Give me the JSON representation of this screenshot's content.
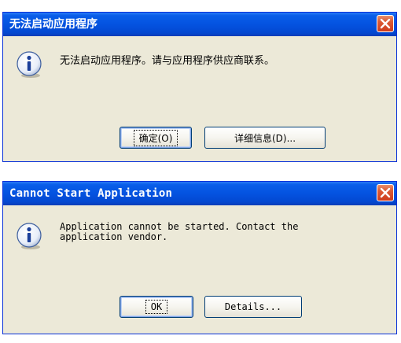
{
  "dialog_cn": {
    "title": "无法启动应用程序",
    "message": "无法启动应用程序。请与应用程序供应商联系。",
    "ok_label": "确定(O)",
    "details_label": "详细信息(D)...",
    "icon": "info-icon",
    "close_icon": "close-icon"
  },
  "dialog_en": {
    "title": "Cannot Start Application",
    "message": "Application cannot be started. Contact the\napplication vendor.",
    "ok_label": "OK",
    "details_label": "Details...",
    "icon": "info-icon",
    "close_icon": "close-icon"
  },
  "colors": {
    "titlebar": "#0453e0",
    "dialog_bg": "#ece9d8",
    "close_button": "#cf3b1c",
    "button_border": "#003c74"
  }
}
